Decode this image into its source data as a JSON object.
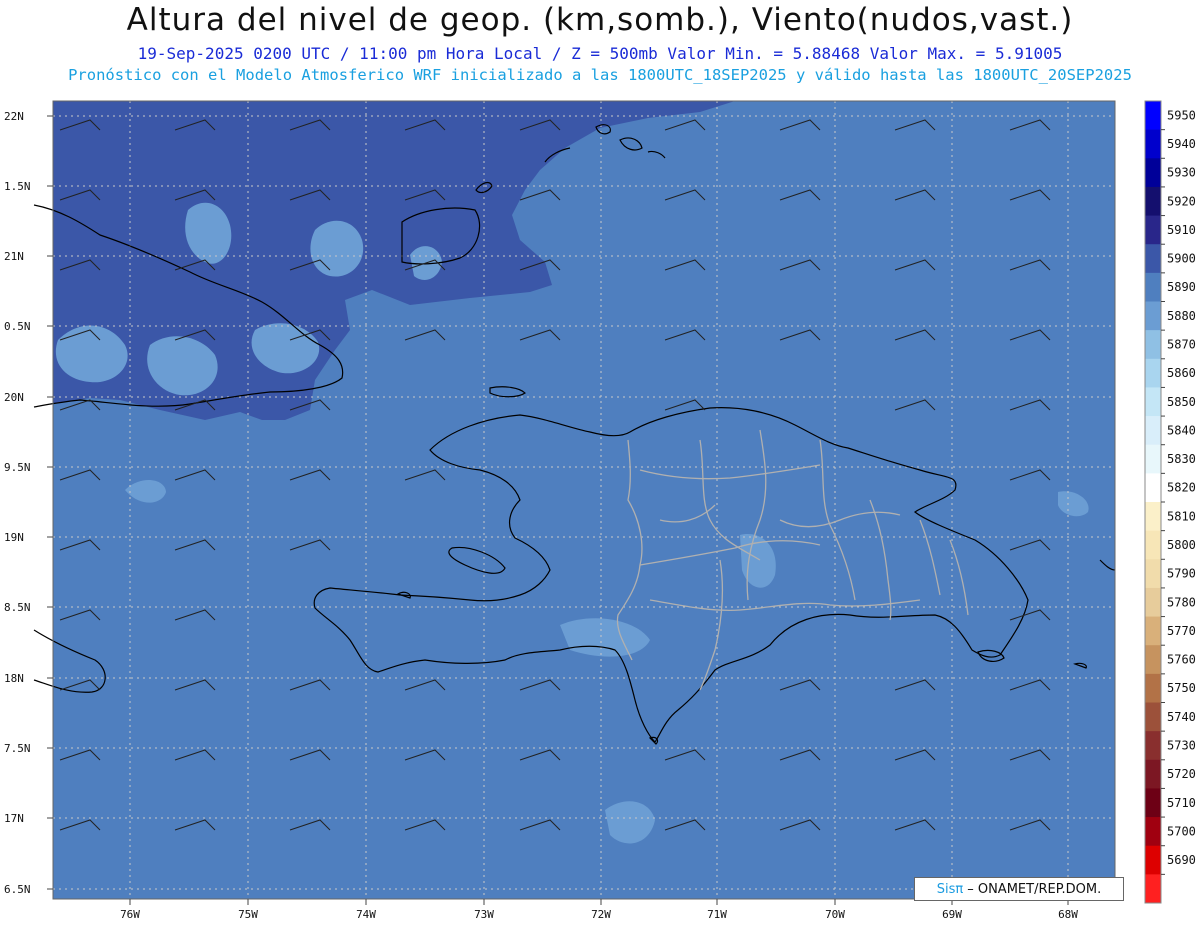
{
  "header": {
    "title": "Altura del nivel de geop. (km,somb.), Viento(nudos,vast.)",
    "subtitle": "19-Sep-2025  0200 UTC / 11:00 pm Hora Local / Z = 500mb    Valor Min. = 5.88468  Valor Max. = 5.91005",
    "info": "Pronóstico con el Modelo Atmosferico WRF inicializado a las 1800UTC_18SEP2025 y válido hasta las  1800UTC_20SEP2025"
  },
  "map": {
    "lon_range": [
      -76.65,
      -67.6
    ],
    "lat_range": [
      16.43,
      22.13
    ],
    "lon_ticks": [
      "76W",
      "75W",
      "74W",
      "73W",
      "72W",
      "71W",
      "70W",
      "69W",
      "68W"
    ],
    "lat_ticks": [
      "22N",
      "1.5N",
      "21N",
      "0.5N",
      "20N",
      "9.5N",
      "19N",
      "8.5N",
      "18N",
      "7.5N",
      "17N",
      "6.5N"
    ],
    "fill_colors": {
      "c5890": "#4f7fbf",
      "c5900": "#3b57a8",
      "c5880": "#6b9dd3",
      "coast": "#000000",
      "borders": "#b0b0b0"
    }
  },
  "colorbar": {
    "labels": [
      "5950",
      "5940",
      "5930",
      "5920",
      "5910",
      "5900",
      "5890",
      "5880",
      "5870",
      "5860",
      "5850",
      "5840",
      "5830",
      "5820",
      "5810",
      "5800",
      "5790",
      "5780",
      "5770",
      "5760",
      "5750",
      "5740",
      "5730",
      "5720",
      "5710",
      "5700",
      "5690"
    ],
    "colors": [
      "#0000ff",
      "#0000cc",
      "#000099",
      "#140f6e",
      "#29268a",
      "#3b57a8",
      "#4f7fbf",
      "#6b9dd3",
      "#8fc0e4",
      "#a9d5ef",
      "#c4e6f6",
      "#d9eefa",
      "#e8f7fb",
      "#ffffff",
      "#fbf0c9",
      "#f7e6b7",
      "#f1dcab",
      "#e7cc9b",
      "#d9b07a",
      "#c6935f",
      "#b27247",
      "#9c513a",
      "#892f2e",
      "#7c1723",
      "#6d0015",
      "#a00010",
      "#dd0000",
      "#ff2020"
    ]
  },
  "credit": {
    "brand": "Sisπ",
    "text": "– ONAMET/REP.DOM."
  }
}
